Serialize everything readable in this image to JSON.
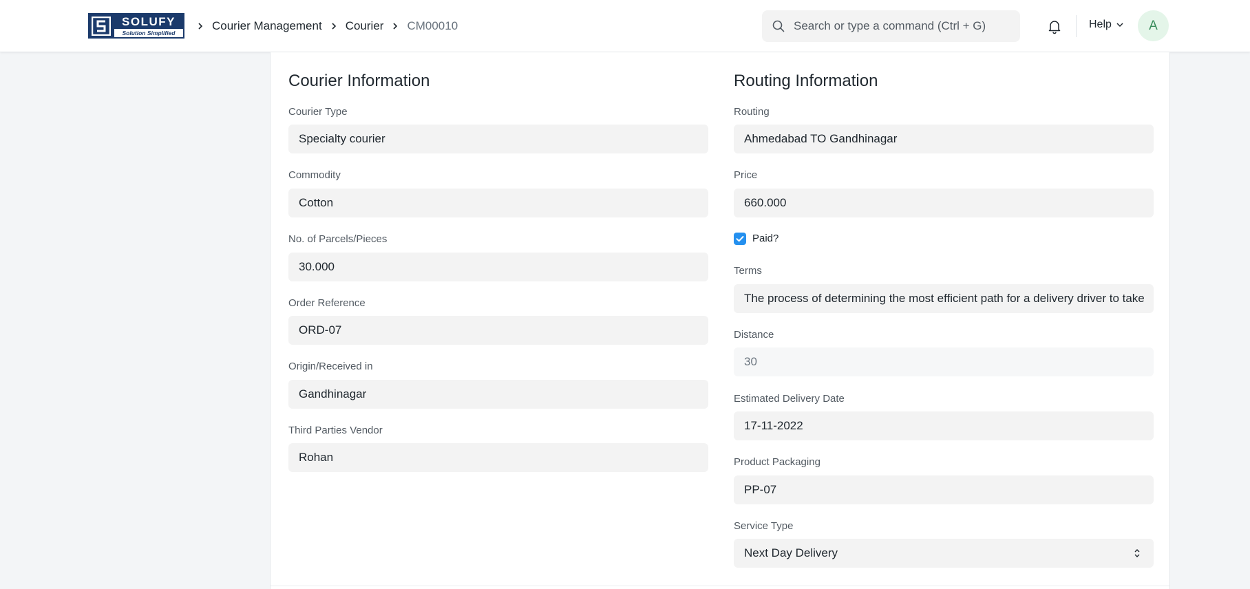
{
  "brand": {
    "name": "SOLUFY",
    "tagline": "Solution Simplified"
  },
  "breadcrumb": [
    "Courier Management",
    "Courier",
    "CM00010"
  ],
  "search": {
    "placeholder": "Search or type a command (Ctrl + G)"
  },
  "help_label": "Help",
  "avatar_initial": "A",
  "courier_info": {
    "title": "Courier Information",
    "fields": [
      {
        "label": "Courier Type",
        "value": "Specialty courier"
      },
      {
        "label": "Commodity",
        "value": "Cotton"
      },
      {
        "label": "No. of Parcels/Pieces",
        "value": "30.000"
      },
      {
        "label": "Order Reference",
        "value": "ORD-07"
      },
      {
        "label": "Origin/Received in",
        "value": "Gandhinagar"
      },
      {
        "label": "Third Parties Vendor",
        "value": "Rohan"
      }
    ]
  },
  "routing_info": {
    "title": "Routing Information",
    "routing": {
      "label": "Routing",
      "value": "Ahmedabad TO Gandhinagar"
    },
    "price": {
      "label": "Price",
      "value": "660.000"
    },
    "paid": {
      "label": "Paid?",
      "checked": true
    },
    "terms": {
      "label": "Terms",
      "value": "The process of determining the most efficient path for a delivery driver to take"
    },
    "distance": {
      "label": "Distance",
      "value": "30"
    },
    "estimated_delivery_date": {
      "label": "Estimated Delivery Date",
      "value": "17-11-2022"
    },
    "product_packaging": {
      "label": "Product Packaging",
      "value": "PP-07"
    },
    "service_type": {
      "label": "Service Type",
      "value": "Next Day Delivery"
    }
  },
  "colors": {
    "accent": "#2490ef",
    "brand": "#1b3a6b",
    "avatar_bg": "#e4f5e9",
    "avatar_fg": "#3a8d5c"
  }
}
